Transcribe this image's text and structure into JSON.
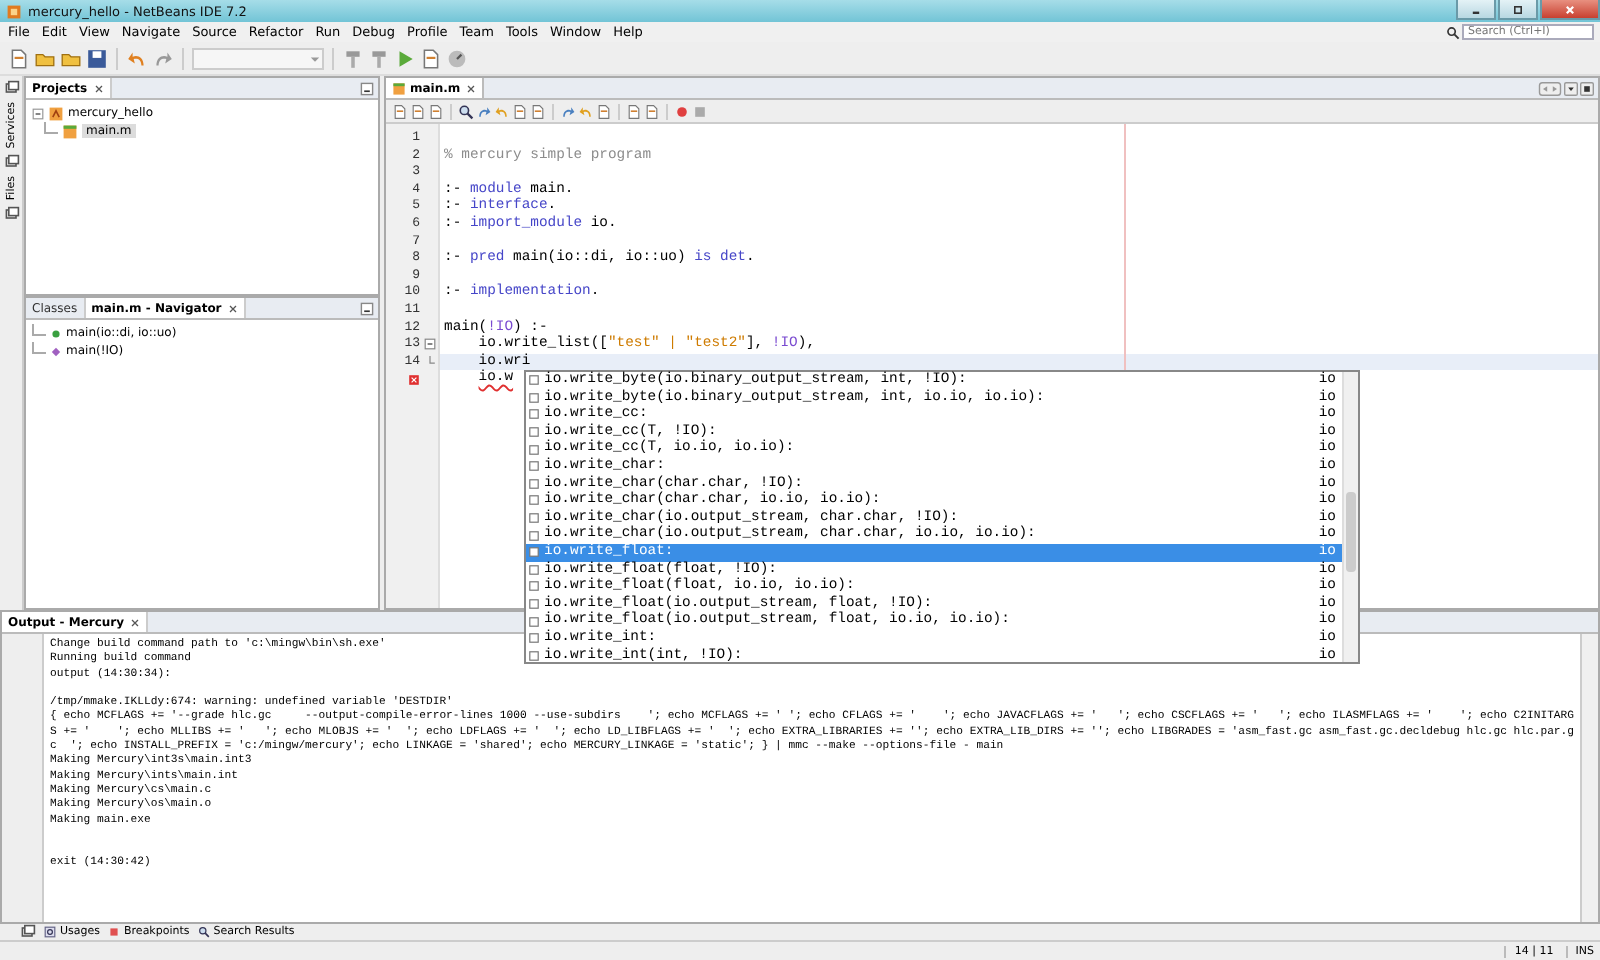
{
  "window": {
    "title": "mercury_hello - NetBeans IDE 7.2"
  },
  "menu": [
    "File",
    "Edit",
    "View",
    "Navigate",
    "Source",
    "Refactor",
    "Run",
    "Debug",
    "Profile",
    "Team",
    "Tools",
    "Window",
    "Help"
  ],
  "search": {
    "placeholder": "Search (Ctrl+I)"
  },
  "side_strip": [
    "Services",
    "Files"
  ],
  "projects_panel": {
    "title": "Projects",
    "tree": [
      {
        "label": "mercury_hello",
        "expanded": true,
        "children": [
          {
            "label": "main.m",
            "selected": true
          }
        ]
      }
    ]
  },
  "navigator_panel": {
    "tabs": [
      {
        "label": "Classes",
        "selected": false
      },
      {
        "label": "main.m - Navigator",
        "selected": true
      }
    ],
    "items": [
      {
        "label": "main(io::di, io::uo)",
        "kind": "predicate"
      },
      {
        "label": "main(!IO)",
        "kind": "clause"
      }
    ]
  },
  "editor": {
    "tabs": [
      {
        "label": "main.m",
        "selected": true
      }
    ],
    "lines": [
      {
        "number": "1",
        "kind": "plain",
        "current": false
      },
      {
        "number": "2",
        "kind": "plain",
        "current": false,
        "tokens": [
          {
            "text": "% mercury simple program",
            "kind": "comment"
          }
        ]
      },
      {
        "number": "3",
        "kind": "plain",
        "current": false
      },
      {
        "number": "4",
        "kind": "plain",
        "current": false,
        "tokens": [
          {
            "text": ":- ",
            "kind": "plain"
          },
          {
            "text": "module",
            "kind": "keyword"
          },
          {
            "text": " main.",
            "kind": "plain"
          }
        ]
      },
      {
        "number": "5",
        "kind": "plain",
        "current": false,
        "tokens": [
          {
            "text": ":- ",
            "kind": "plain"
          },
          {
            "text": "interface",
            "kind": "keyword"
          },
          {
            "text": ".",
            "kind": "plain"
          }
        ]
      },
      {
        "number": "6",
        "kind": "plain",
        "current": false,
        "tokens": [
          {
            "text": ":- ",
            "kind": "plain"
          },
          {
            "text": "import_module",
            "kind": "keyword"
          },
          {
            "text": " io.",
            "kind": "plain"
          }
        ]
      },
      {
        "number": "7",
        "kind": "plain",
        "current": false
      },
      {
        "number": "8",
        "kind": "plain",
        "current": false,
        "tokens": [
          {
            "text": ":- ",
            "kind": "plain"
          },
          {
            "text": "pred",
            "kind": "keyword"
          },
          {
            "text": " main(io::di, io::uo) ",
            "kind": "plain"
          },
          {
            "text": "is det",
            "kind": "keyword"
          },
          {
            "text": ".",
            "kind": "plain"
          }
        ]
      },
      {
        "number": "9",
        "kind": "plain",
        "current": false
      },
      {
        "number": "10",
        "kind": "plain",
        "current": false,
        "tokens": [
          {
            "text": ":- ",
            "kind": "plain"
          },
          {
            "text": "implementation",
            "kind": "keyword"
          },
          {
            "text": ".",
            "kind": "plain"
          }
        ]
      },
      {
        "number": "11",
        "kind": "plain",
        "current": false
      },
      {
        "number": "12",
        "kind": "plain",
        "current": false,
        "tokens": [
          {
            "text": "main(",
            "kind": "plain"
          },
          {
            "text": "!IO",
            "kind": "variable"
          },
          {
            "text": ") :-",
            "kind": "plain"
          }
        ]
      },
      {
        "number": "13",
        "kind": "fold_start",
        "current": false,
        "tokens": [
          {
            "text": "    io.write_list([",
            "kind": "plain"
          },
          {
            "text": "\"test\" | \"test2\"",
            "kind": "string"
          },
          {
            "text": "], ",
            "kind": "plain"
          },
          {
            "text": "!IO",
            "kind": "variable"
          },
          {
            "text": "),",
            "kind": "plain"
          }
        ]
      },
      {
        "number": "14",
        "kind": "fold_end",
        "current": true,
        "tokens": [
          {
            "text": "    io.wri",
            "kind": "plain"
          }
        ]
      },
      {
        "kind": "error",
        "current": false,
        "tokens": [
          {
            "text": "    io.w",
            "kind": "error"
          }
        ]
      }
    ]
  },
  "completion": {
    "items": [
      {
        "text": "io.write_byte(io.binary_output_stream, int, !IO):",
        "module": "io",
        "selected": false
      },
      {
        "text": "io.write_byte(io.binary_output_stream, int, io.io, io.io):",
        "module": "io",
        "selected": false
      },
      {
        "text": "io.write_cc:",
        "module": "io",
        "selected": false
      },
      {
        "text": "io.write_cc(T, !IO):",
        "module": "io",
        "selected": false
      },
      {
        "text": "io.write_cc(T, io.io, io.io):",
        "module": "io",
        "selected": false
      },
      {
        "text": "io.write_char:",
        "module": "io",
        "selected": false
      },
      {
        "text": "io.write_char(char.char, !IO):",
        "module": "io",
        "selected": false
      },
      {
        "text": "io.write_char(char.char, io.io, io.io):",
        "module": "io",
        "selected": false
      },
      {
        "text": "io.write_char(io.output_stream, char.char, !IO):",
        "module": "io",
        "selected": false
      },
      {
        "text": "io.write_char(io.output_stream, char.char, io.io, io.io):",
        "module": "io",
        "selected": false
      },
      {
        "text": "io.write_float:",
        "module": "io",
        "selected": true
      },
      {
        "text": "io.write_float(float, !IO):",
        "module": "io",
        "selected": false
      },
      {
        "text": "io.write_float(float, io.io, io.io):",
        "module": "io",
        "selected": false
      },
      {
        "text": "io.write_float(io.output_stream, float, !IO):",
        "module": "io",
        "selected": false
      },
      {
        "text": "io.write_float(io.output_stream, float, io.io, io.io):",
        "module": "io",
        "selected": false
      },
      {
        "text": "io.write_int:",
        "module": "io",
        "selected": false
      },
      {
        "text": "io.write_int(int, !IO):",
        "module": "io",
        "selected": false
      }
    ]
  },
  "output": {
    "title": "Output - Mercury",
    "blocks": [
      [
        "Change build command path to 'c:\\mingw\\bin\\sh.exe'",
        "Running build command",
        "output (14:30:34):"
      ],
      [
        "/tmp/mmake.IKLLdy:674: warning: undefined variable 'DESTDIR'",
        "{ echo MCFLAGS += '--grade hlc.gc     --output-compile-error-lines 1000 --use-subdirs    '; echo MCFLAGS += ' '; echo CFLAGS += '    '; echo JAVACFLAGS += '   '; echo CSCFLAGS += '   '; echo ILASMFLAGS += '    '; echo C2INITARG",
        "S += '    '; echo MLLIBS += '   '; echo MLOBJS += '  '; echo LDFLAGS += '  '; echo LD_LIBFLAGS += '  '; echo EXTRA_LIBRARIES += ''; echo EXTRA_LIB_DIRS += ''; echo LIBGRADES = 'asm_fast.gc asm_fast.gc.decldebug hlc.gc hlc.par.g",
        "c  '; echo INSTALL_PREFIX = 'c:/mingw/mercury'; echo LINKAGE = 'shared'; echo MERCURY_LINKAGE = 'static'; } | mmc --make --options-file - main",
        "Making Mercury\\int3s\\main.int3",
        "Making Mercury\\ints\\main.int",
        "Making Mercury\\cs\\main.c",
        "Making Mercury\\os\\main.o",
        "Making main.exe"
      ],
      [
        "exit (14:30:42)"
      ]
    ]
  },
  "bottom_tabs": [
    {
      "label": "Usages",
      "kind": "usages"
    },
    {
      "label": "Breakpoints",
      "kind": "breakpoints"
    },
    {
      "label": "Search Results",
      "kind": "search"
    }
  ],
  "status_bar": {
    "position": "14 | 11",
    "mode": "INS"
  }
}
